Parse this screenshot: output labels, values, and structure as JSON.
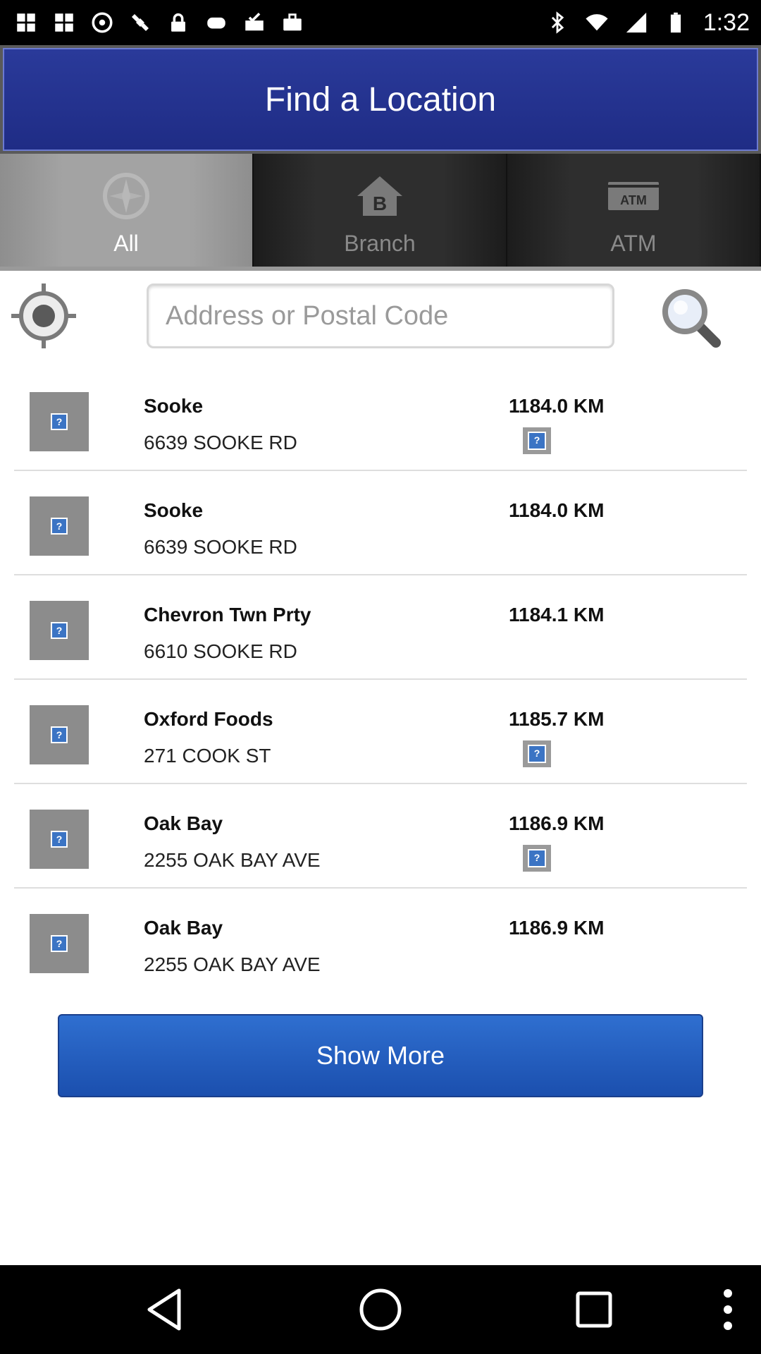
{
  "status_bar": {
    "time": "1:32",
    "left_icons": [
      "app-grid-icon",
      "app-grid-icon",
      "sync-circle-icon",
      "satellite-fake-gps-icon",
      "lock-icon",
      "game-controller-icon",
      "inbox-check-icon",
      "briefcase-icon"
    ],
    "right_icons": [
      "bluetooth-icon",
      "wifi-icon",
      "signal-icon",
      "battery-icon"
    ]
  },
  "header": {
    "title": "Find a Location"
  },
  "tabs": [
    {
      "label": "All",
      "icon": "compass-icon",
      "active": true
    },
    {
      "label": "Branch",
      "icon": "branch-house-icon",
      "active": false
    },
    {
      "label": "ATM",
      "icon": "atm-icon",
      "active": false
    }
  ],
  "search": {
    "placeholder": "Address or Postal Code",
    "value": ""
  },
  "locations": [
    {
      "name": "Sooke",
      "address": "6639 SOOKE RD",
      "distance": "1184.0 KM",
      "has_badge": true
    },
    {
      "name": "Sooke",
      "address": "6639 SOOKE RD",
      "distance": "1184.0 KM",
      "has_badge": false
    },
    {
      "name": "Chevron Twn Prty",
      "address": "6610 SOOKE RD",
      "distance": "1184.1 KM",
      "has_badge": false
    },
    {
      "name": "Oxford Foods",
      "address": "271 COOK ST",
      "distance": "1185.7 KM",
      "has_badge": true
    },
    {
      "name": "Oak Bay",
      "address": "2255 OAK BAY AVE",
      "distance": "1186.9 KM",
      "has_badge": true
    },
    {
      "name": "Oak Bay",
      "address": "2255 OAK BAY AVE",
      "distance": "1186.9 KM",
      "has_badge": false
    }
  ],
  "show_more_label": "Show More",
  "colors": {
    "header_blue": "#1f2c85",
    "button_blue": "#2460c0"
  }
}
